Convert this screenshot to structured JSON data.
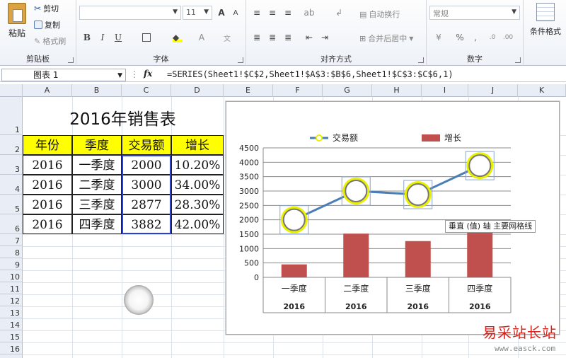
{
  "ribbon": {
    "clipboard": {
      "paste": "粘贴",
      "cut": "剪切",
      "copy": "复制",
      "format_painter": "格式刷",
      "label": "剪贴板"
    },
    "font": {
      "size": "11",
      "label": "字体",
      "bold": "B",
      "italic": "I",
      "underline": "U",
      "grow": "A",
      "shrink": "A"
    },
    "alignment": {
      "wrap_text": "自动换行",
      "merge_center": "合并后居中",
      "label": "对齐方式"
    },
    "number": {
      "format": "常规",
      "percent": "%",
      "comma": ",",
      "label": "数字"
    },
    "styles": {
      "conditional_format": "条件格式"
    }
  },
  "formula_bar": {
    "name_box": "图表 1",
    "fx": "fx",
    "formula": "=SERIES(Sheet1!$C$2,Sheet1!$A$3:$B$6,Sheet1!$C$3:$C$6,1)"
  },
  "columns": [
    "A",
    "B",
    "C",
    "D",
    "E",
    "F",
    "G",
    "H",
    "I",
    "J",
    "K"
  ],
  "rows": [
    "1",
    "2",
    "3",
    "4",
    "5",
    "6",
    "7",
    "8",
    "9",
    "10",
    "11",
    "12",
    "13",
    "14",
    "15",
    "16"
  ],
  "table": {
    "title": "2016年销售表",
    "headers": [
      "年份",
      "季度",
      "交易额",
      "增长"
    ],
    "rows": [
      [
        "2016",
        "一季度",
        "2000",
        "10.20%"
      ],
      [
        "2016",
        "二季度",
        "3000",
        "34.00%"
      ],
      [
        "2016",
        "三季度",
        "2877",
        "28.30%"
      ],
      [
        "2016",
        "四季度",
        "3882",
        "42.00%"
      ]
    ]
  },
  "chart_data": {
    "type": "bar",
    "categories": [
      "一季度",
      "二季度",
      "三季度",
      "四季度"
    ],
    "category_group": [
      "2016",
      "2016",
      "2016",
      "2016"
    ],
    "series": [
      {
        "name": "交易额",
        "type": "line",
        "values": [
          2000,
          3000,
          2877,
          3882
        ],
        "color": "#4a7eb5"
      },
      {
        "name": "增长",
        "type": "bar",
        "values": [
          450,
          1520,
          1260,
          1640
        ],
        "color": "#c0504d"
      }
    ],
    "ylim": [
      0,
      4500
    ],
    "yticks": [
      0,
      500,
      1000,
      1500,
      2000,
      2500,
      3000,
      3500,
      4000,
      4500
    ],
    "grid": true,
    "legend": "top"
  },
  "tooltip": "垂直 (值) 轴 主要网格线",
  "watermark": {
    "text": "易采站长站",
    "url": "www.easck.com"
  },
  "colors": {
    "header_fill": "#ffff00",
    "marker_ring": "#e9f000",
    "bar": "#c0504d",
    "line": "#4a7eb5"
  }
}
